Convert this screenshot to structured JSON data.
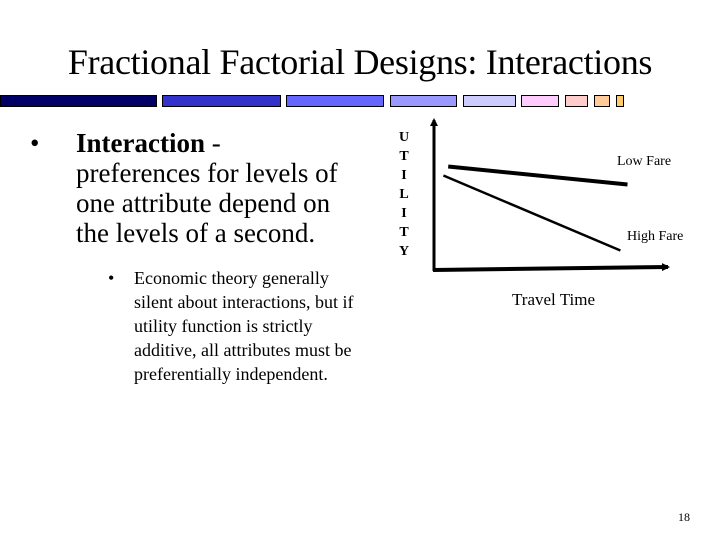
{
  "slide": {
    "title": "Fractional Factorial Designs: Interactions",
    "page_number": "18",
    "decor_bar_colors": [
      "#000066",
      "#3333cc",
      "#6666ff",
      "#9999ff",
      "#ccccff",
      "#ffccff",
      "#ffcccc",
      "#ffcc99",
      "#ffcc66"
    ]
  },
  "bullets": [
    {
      "marker": "•",
      "term": "Interaction",
      "separator": " -",
      "text": "preferences for levels of one attribute depend on the levels of a second."
    },
    {
      "marker": "•",
      "text": "Economic theory generally silent about interactions, but if utility function is strictly additive, all attributes must be preferentially independent."
    }
  ],
  "chart_data": {
    "type": "line",
    "title": "",
    "xlabel": "Travel Time",
    "ylabel": "UTILITY",
    "ylabel_letters": [
      "U",
      "T",
      "I",
      "L",
      "I",
      "T",
      "Y"
    ],
    "x_ticks": [],
    "y_ticks": [],
    "grid": false,
    "xlim": [
      0,
      1
    ],
    "ylim": [
      0,
      1
    ],
    "series": [
      {
        "name": "Low Fare",
        "x": [
          0.06,
          0.82
        ],
        "y": [
          0.69,
          0.57
        ]
      },
      {
        "name": "High Fare",
        "x": [
          0.04,
          0.79
        ],
        "y": [
          0.63,
          0.13
        ]
      }
    ]
  }
}
